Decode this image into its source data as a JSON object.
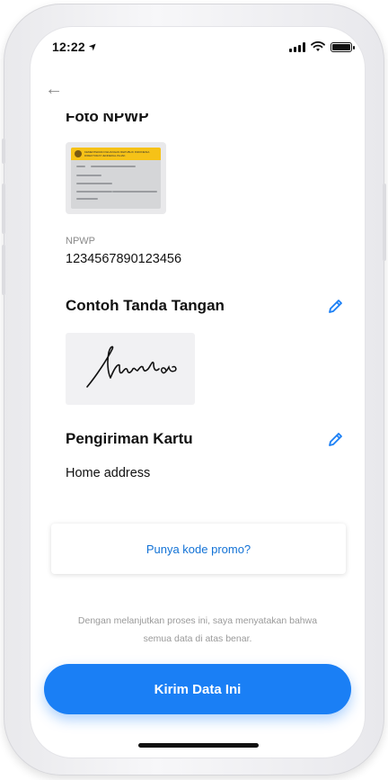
{
  "status_bar": {
    "time": "12:22",
    "location_arrow": "➤"
  },
  "nav": {
    "back_icon": "←"
  },
  "sections": {
    "foto_npwp_title": "Foto NPWP",
    "npwp_label": "NPWP",
    "npwp_value": "1234567890123456",
    "signature_title": "Contoh Tanda Tangan",
    "delivery_title": "Pengiriman Kartu",
    "delivery_value": "Home address"
  },
  "npwp_card": {
    "header_line1": "KEMENTERIAN KEUANGAN REPUBLIK INDONESIA",
    "header_line2": "DIREKTORAT JENDERAL PAJAK"
  },
  "promo": {
    "label": "Punya kode promo?"
  },
  "disclaimer": {
    "line1": "Dengan melanjutkan proses ini, saya menyatakan bahwa",
    "line2": "semua data di atas benar."
  },
  "submit": {
    "label": "Kirim Data Ini"
  },
  "colors": {
    "accent": "#1a7ff5",
    "link": "#1272d6",
    "muted": "#8a8a8a"
  },
  "icons": {
    "edit": "pencil-icon",
    "back": "arrow-left-icon"
  }
}
